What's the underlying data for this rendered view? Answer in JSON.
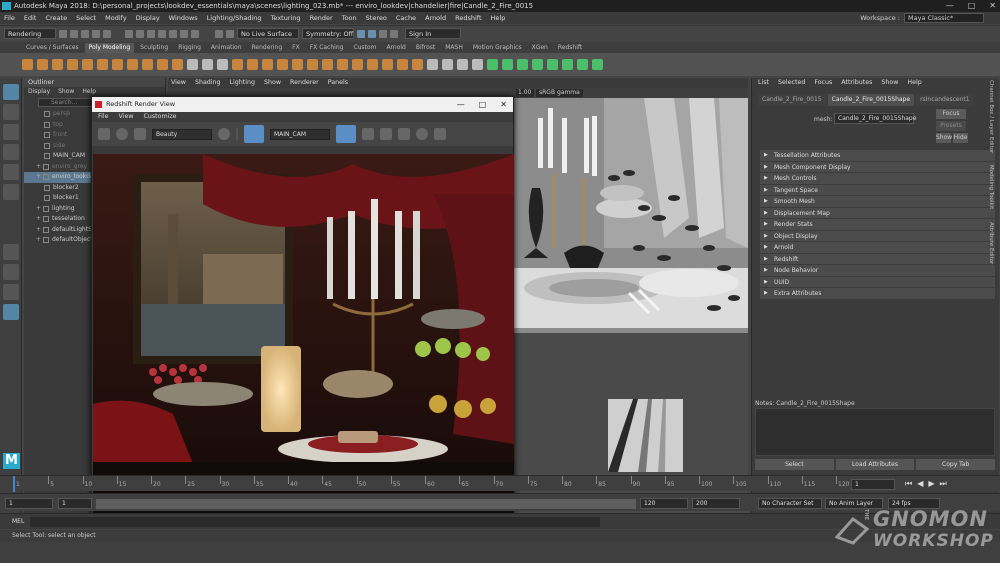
{
  "window": {
    "title": "Autodesk Maya 2018: D:\\personal_projects\\lookdev_essentials\\maya\\scenes\\lighting_023.mb* --- enviro_lookdev|chandelier|fire|Candle_2_Fire_0015",
    "controls": [
      "—",
      "□",
      "✕"
    ]
  },
  "menubar": [
    "File",
    "Edit",
    "Create",
    "Select",
    "Modify",
    "Display",
    "Windows",
    "Lighting/Shading",
    "Texturing",
    "Render",
    "Toon",
    "Stereo",
    "Cache",
    "Arnold",
    "Redshift",
    "Help"
  ],
  "workspace": {
    "label": "Workspace :",
    "value": "Maya Classic*"
  },
  "status_line": {
    "menu_set": "Rendering",
    "live_surface": "No Live Surface",
    "symmetry": "Symmetry: Off",
    "sign_in": "Sign In"
  },
  "shelf_tabs": [
    "Curves / Surfaces",
    "Poly Modeling",
    "Sculpting",
    "Rigging",
    "Animation",
    "Rendering",
    "FX",
    "FX Caching",
    "Custom",
    "Arnold",
    "Bifrost",
    "MASH",
    "Motion Graphics",
    "XGen",
    "Redshift"
  ],
  "shelf_active": "Poly Modeling",
  "outliner": {
    "title": "Outliner",
    "menu": [
      "Display",
      "Show",
      "Help"
    ],
    "search_placeholder": "Search...",
    "items": [
      {
        "label": "persp",
        "dim": true,
        "highlight": false
      },
      {
        "label": "top",
        "dim": true,
        "highlight": false
      },
      {
        "label": "front",
        "dim": true,
        "highlight": false
      },
      {
        "label": "side",
        "dim": true,
        "highlight": false
      },
      {
        "label": "MAIN_CAM",
        "dim": false,
        "highlight": false
      },
      {
        "label": "enviro_grey",
        "dim": true,
        "highlight": false
      },
      {
        "label": "enviro_lookdev",
        "dim": false,
        "highlight": true
      },
      {
        "label": "blocker2",
        "dim": false,
        "highlight": false
      },
      {
        "label": "blocker1",
        "dim": false,
        "highlight": false
      },
      {
        "label": "lighting",
        "dim": false,
        "highlight": false
      },
      {
        "label": "tesselation",
        "dim": false,
        "highlight": false
      },
      {
        "label": "defaultLightSet",
        "dim": false,
        "highlight": false
      },
      {
        "label": "defaultObjectSet",
        "dim": false,
        "highlight": false
      }
    ]
  },
  "viewport": {
    "menu": [
      "View",
      "Shading",
      "Lighting",
      "Show",
      "Renderer",
      "Panels"
    ],
    "exposure": "0.00",
    "gamma_value": "1.00",
    "color_space": "sRGB gamma"
  },
  "render_view": {
    "title": "Redshift Render View",
    "menu": [
      "File",
      "View",
      "Customize"
    ],
    "aov": "Beauty",
    "camera": "MAIN_CAM",
    "controls": [
      "—",
      "□",
      "✕"
    ]
  },
  "attribute_editor": {
    "menu": [
      "List",
      "Selected",
      "Focus",
      "Attributes",
      "Show",
      "Help"
    ],
    "tabs": [
      "Candle_2_Fire_0015",
      "Candle_2_Fire_0015Shape",
      "rsIncandescent1"
    ],
    "mesh_label": "mesh:",
    "mesh_value": "Candle_2_Fire_0015Shape",
    "buttons": [
      "Focus",
      "Presets",
      "Show",
      "Hide"
    ],
    "sections": [
      "Tessellation Attributes",
      "Mesh Component Display",
      "Mesh Controls",
      "Tangent Space",
      "Smooth Mesh",
      "Displacement Map",
      "Render Stats",
      "Object Display",
      "Arnold",
      "Redshift",
      "Node Behavior",
      "UUID",
      "Extra Attributes"
    ],
    "notes": "Notes:  Candle_2_Fire_0015Shape",
    "bottom_buttons": [
      "Select",
      "Load Attributes",
      "Copy Tab"
    ],
    "side_tabs": [
      "Channel Box / Layer Editor",
      "Modeling Toolkit",
      "Attribute Editor"
    ]
  },
  "timeline": {
    "ticks": [
      "1",
      "5",
      "10",
      "15",
      "20",
      "25",
      "30",
      "35",
      "40",
      "45",
      "50",
      "55",
      "60",
      "65",
      "70",
      "75",
      "80",
      "85",
      "90",
      "95",
      "100",
      "105",
      "110",
      "115",
      "120"
    ],
    "current_frame": "1"
  },
  "range": {
    "start": "1",
    "start2": "1",
    "end_inner": "120",
    "end_outer": "120",
    "end2": "200",
    "character_set": "No Character Set",
    "anim_layer": "No Anim Layer",
    "fps": "24 fps"
  },
  "mel": {
    "label": "MEL"
  },
  "help_line": "Select Tool: select an object",
  "watermark": {
    "small": "THE",
    "line1": "GNOMON",
    "line2": "WORKSHOP"
  }
}
